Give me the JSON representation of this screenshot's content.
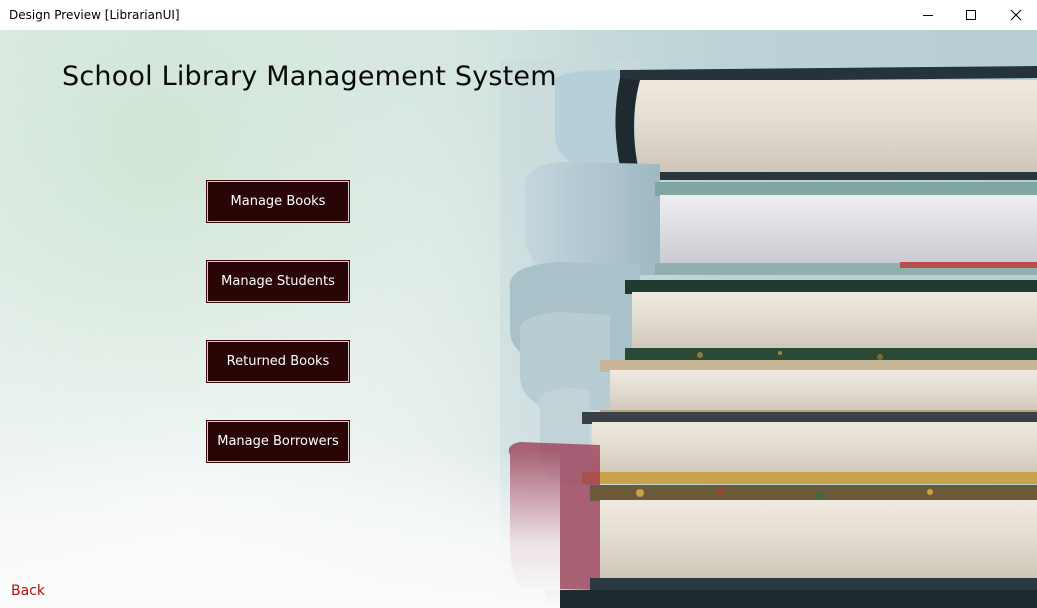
{
  "window": {
    "title": "Design Preview [LibrarianUI]",
    "controls": [
      "minimize-icon",
      "maximize-icon",
      "close-icon"
    ]
  },
  "main": {
    "heading": "School Library Management System",
    "buttons": [
      {
        "label": "Manage Books"
      },
      {
        "label": "Manage Students"
      },
      {
        "label": "Returned Books"
      },
      {
        "label": "Manage Borrowers"
      }
    ],
    "back_label": "Back"
  },
  "colors": {
    "button_bg": "#2a0506",
    "button_text": "#ffffff",
    "back_link": "#b01010",
    "title_text": "#0a0a0a"
  }
}
